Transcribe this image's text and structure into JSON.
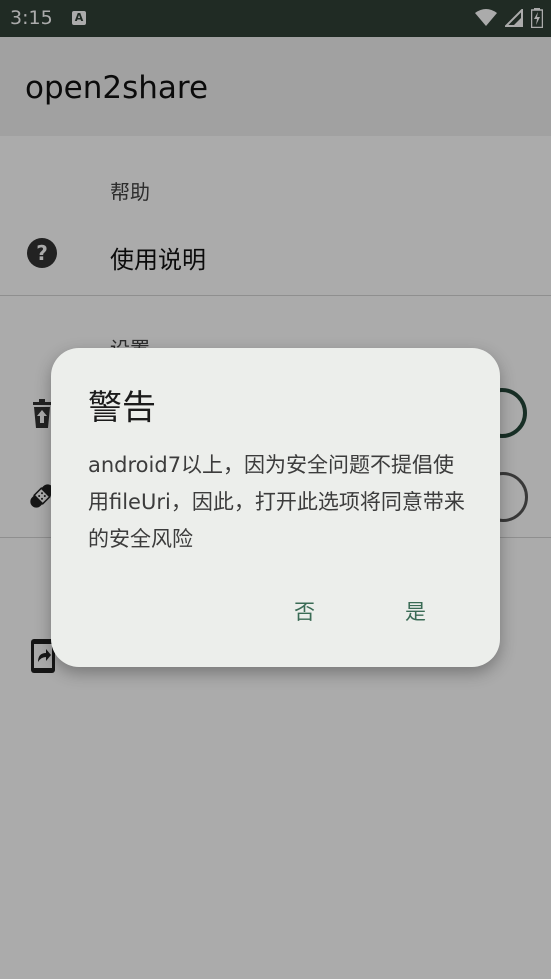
{
  "status_bar": {
    "time": "3:15",
    "notif_letter": "A"
  },
  "app_bar": {
    "title": "open2share"
  },
  "sections": {
    "help": {
      "category": "帮助",
      "usage_item": "使用说明"
    },
    "settings": {
      "category": "设置"
    }
  },
  "dialog": {
    "title": "警告",
    "message": "android7以上，因为安全问题不提倡使用fileUri，因此，打开此选项将同意带来的安全风险",
    "negative_label": "否",
    "positive_label": "是"
  },
  "colors": {
    "status_bar": "#314137",
    "accent": "#3a6b55",
    "dialog_bg": "#eceeeb"
  }
}
